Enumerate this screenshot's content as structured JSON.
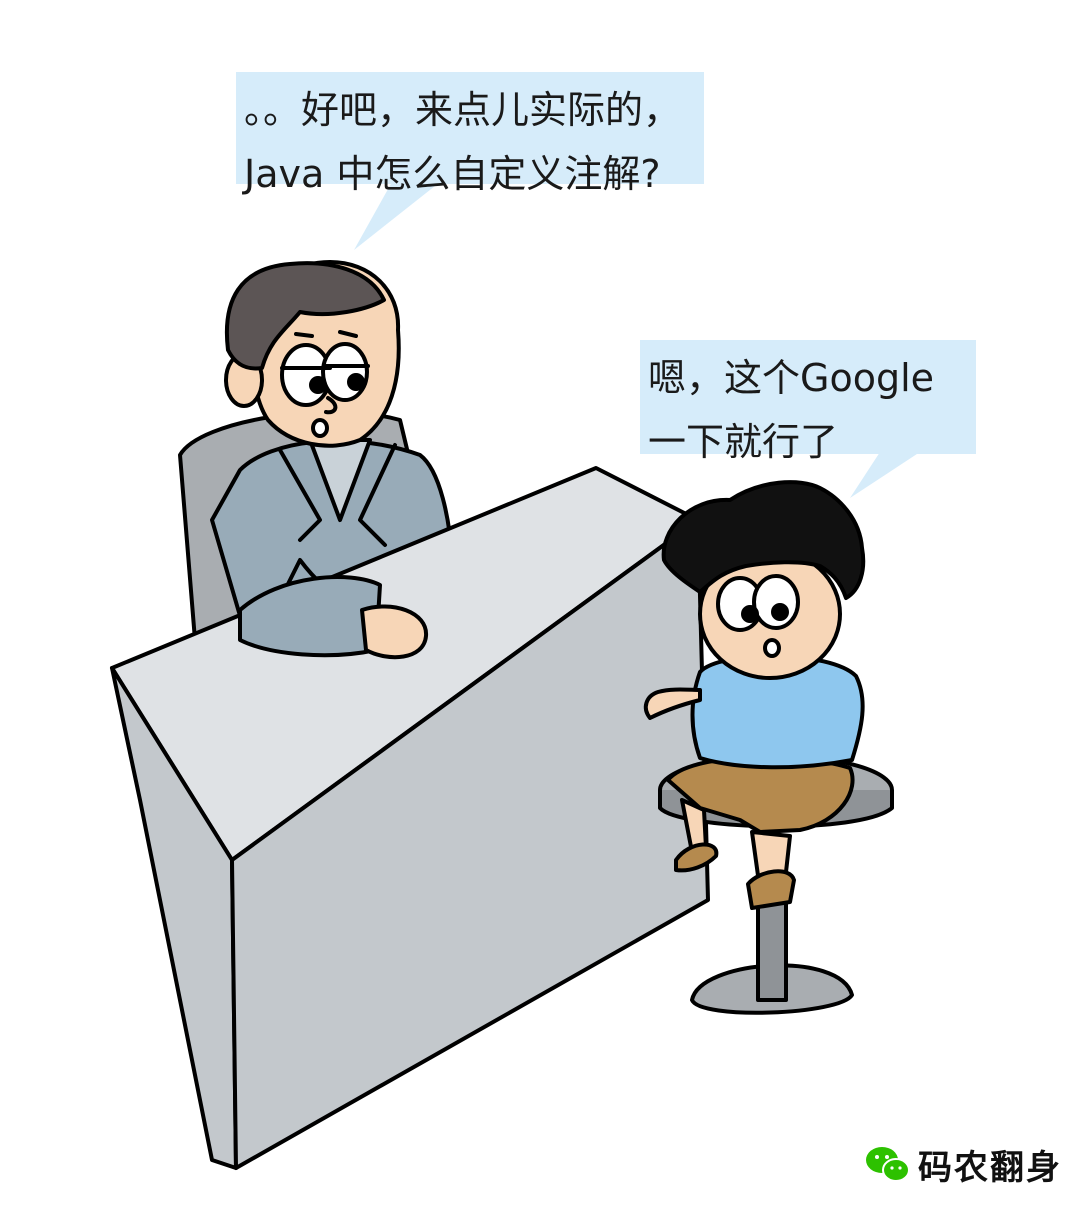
{
  "speech": {
    "interviewer": {
      "line1": "。。好吧，来点儿实际的，",
      "line2": "Java 中怎么自定义注解?"
    },
    "candidate": {
      "line1": "嗯，这个Google",
      "line2": "一下就行了"
    }
  },
  "branding": {
    "icon": "wechat-icon",
    "name": "码农翻身"
  },
  "colors": {
    "bubble": "#d6ecfa",
    "suit": "#98abb8",
    "desk_top": "#dfe2e5",
    "desk_front": "#c3c8cc",
    "shirt": "#8ec7ee",
    "shorts": "#b58a4e",
    "stool": "#a9adb1",
    "wechat": "#2dc100"
  }
}
